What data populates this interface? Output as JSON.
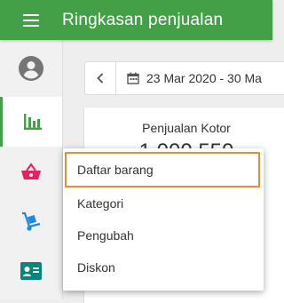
{
  "header": {
    "title": "Ringkasan penjualan"
  },
  "sidebar": {
    "items": [
      {
        "icon": "account-circle-icon",
        "color": "#757575"
      },
      {
        "icon": "bar-chart-icon",
        "color": "#43a047",
        "active": true
      },
      {
        "icon": "basket-icon",
        "color": "#e91e63"
      },
      {
        "icon": "hand-truck-icon",
        "color": "#1e88e5"
      },
      {
        "icon": "id-card-icon",
        "color": "#00897b"
      }
    ]
  },
  "main": {
    "date_range": "23 Mar 2020 - 30 Ma",
    "prev_icon": "chevron-left-icon",
    "calendar_icon": "calendar-icon",
    "card": {
      "title": "Penjualan Kotor",
      "value": "1.000.550"
    }
  },
  "dropdown": {
    "items": [
      {
        "label": "Daftar barang",
        "highlighted": true
      },
      {
        "label": "Kategori"
      },
      {
        "label": "Pengubah"
      },
      {
        "label": "Diskon"
      }
    ]
  },
  "colors": {
    "accent": "#43a047",
    "highlight_border": "#f08a30"
  }
}
